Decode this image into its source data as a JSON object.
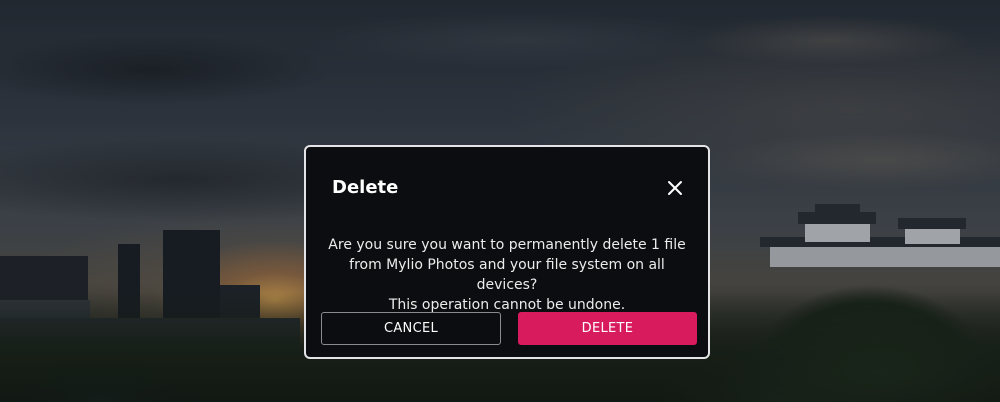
{
  "dialog": {
    "title": "Delete",
    "message": "Are you sure you want to permanently delete 1 file\nfrom Mylio Photos and your file system on all devices?\nThis operation cannot be undone.",
    "close_icon": "close-icon",
    "cancel_label": "CANCEL",
    "delete_label": "DELETE"
  },
  "colors": {
    "dialog_background": "#0c0d10",
    "dialog_border": "#e4e4e6",
    "delete_button": "#d81b5c",
    "cancel_border": "#8a8c92",
    "text": "#ffffff"
  }
}
